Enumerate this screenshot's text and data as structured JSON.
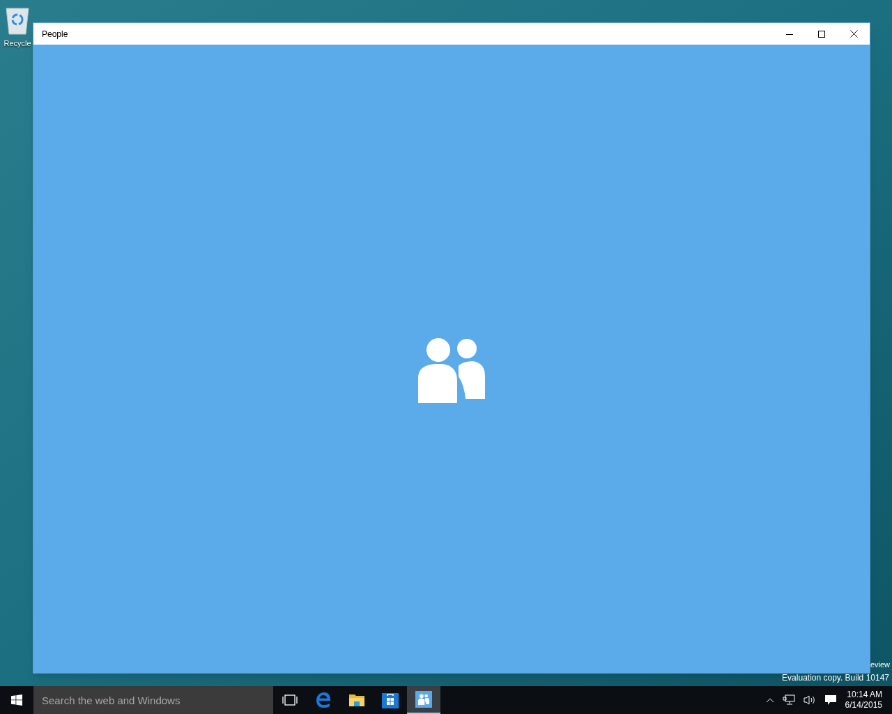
{
  "desktop": {
    "icons": [
      {
        "label": "Recycle"
      }
    ],
    "watermark": {
      "line_1": "eview",
      "line_2": "Evaluation copy. Build 10147"
    }
  },
  "window": {
    "title": "People"
  },
  "taskbar": {
    "search": {
      "placeholder": "Search the web and Windows"
    },
    "apps": [
      {
        "kind": "task-view",
        "selected": false
      },
      {
        "kind": "browser",
        "selected": false
      },
      {
        "kind": "folder",
        "selected": false
      },
      {
        "kind": "store",
        "selected": false
      },
      {
        "kind": "people",
        "selected": true
      }
    ],
    "clock": {
      "time": "10:14 AM",
      "date": "6/14/2015"
    }
  }
}
